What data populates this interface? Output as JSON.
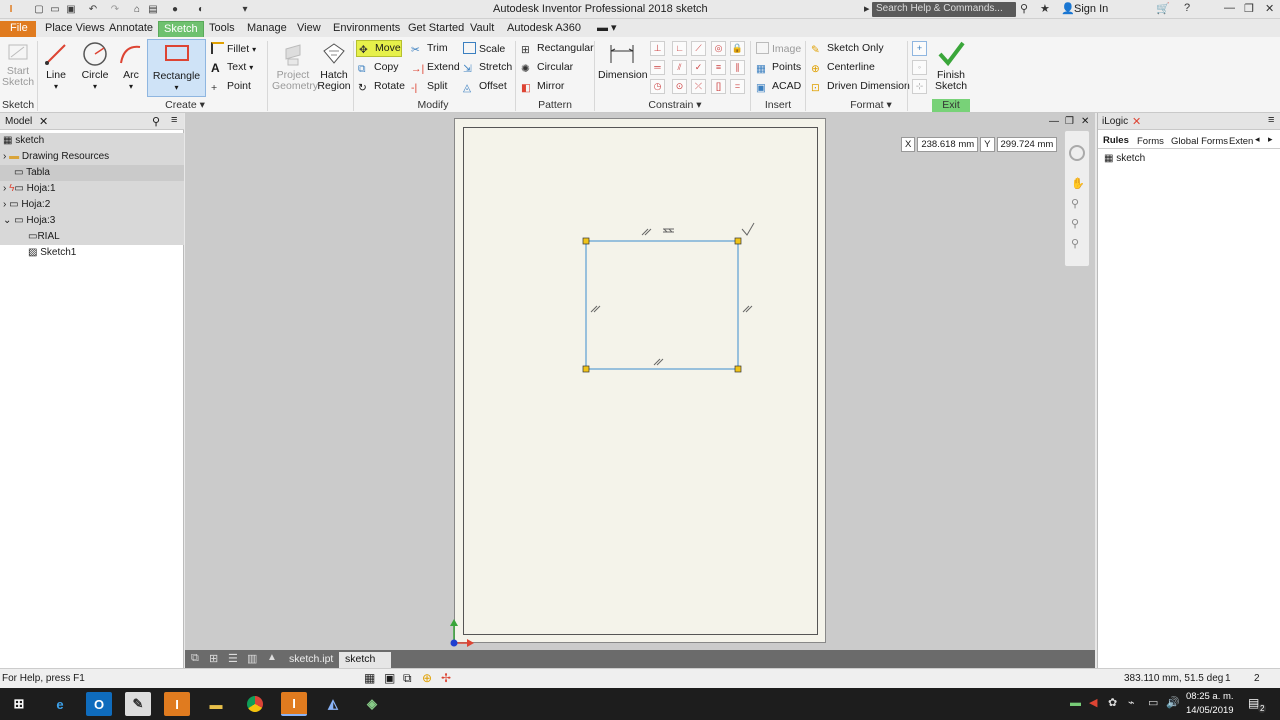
{
  "window": {
    "title": "Autodesk Inventor Professional 2018   sketch",
    "search_placeholder": "Search Help & Commands...",
    "sign_in": "Sign In"
  },
  "tabs": [
    "File",
    "Place Views",
    "Annotate",
    "Sketch",
    "Tools",
    "Manage",
    "View",
    "Environments",
    "Get Started",
    "Vault",
    "Autodesk A360"
  ],
  "ribbon": {
    "create": {
      "start_sketch": [
        "Start",
        "Sketch"
      ],
      "line": "Line",
      "circle": "Circle",
      "arc": "Arc",
      "rectangle": "Rectangle",
      "fillet": "Fillet",
      "text": "Text",
      "point": "Point",
      "project_geometry": [
        "Project",
        "Geometry"
      ],
      "hatch_region": [
        "Hatch",
        "Region"
      ]
    },
    "modify": {
      "move": "Move",
      "copy": "Copy",
      "rotate": "Rotate",
      "trim": "Trim",
      "extend": "Extend",
      "split": "Split",
      "scale": "Scale",
      "stretch": "Stretch",
      "offset": "Offset"
    },
    "pattern": {
      "rectangular": "Rectangular",
      "circular": "Circular",
      "mirror": "Mirror"
    },
    "dimension": "Dimension",
    "insert": {
      "image": "Image",
      "points": "Points",
      "acad": "ACAD"
    },
    "format": {
      "sketch_only": "Sketch Only",
      "centerline": "Centerline",
      "driven_dimension": "Driven Dimension"
    },
    "finish_sketch": [
      "Finish",
      "Sketch"
    ],
    "groups": {
      "sketch": "Sketch",
      "create": "Create",
      "modify": "Modify",
      "pattern": "Pattern",
      "constrain": "Constrain",
      "insert": "Insert",
      "format": "Format",
      "exit": "Exit"
    }
  },
  "model_panel": {
    "tab": "Model",
    "items": [
      "sketch",
      "Drawing Resources",
      "Tabla",
      "Hoja:1",
      "Hoja:2",
      "Hoja:3",
      "RIAL",
      "Sketch1"
    ]
  },
  "coords": {
    "x_label": "X",
    "x_value": "238.618 mm",
    "y_label": "Y",
    "y_value": "299.724 mm"
  },
  "doc_tabs": [
    "sketch.ipt",
    "sketch"
  ],
  "logic_panel": {
    "title": "iLogic",
    "tabs": [
      "Rules",
      "Forms",
      "Global Forms",
      "Exten"
    ],
    "root": "sketch"
  },
  "status": {
    "help": "For Help, press F1",
    "readout": "383.110 mm, 51.5 deg",
    "value1": "1",
    "value2": "2"
  },
  "taskbar": {
    "time": "08:25 a. m.",
    "date": "14/05/2019",
    "notifications": "2"
  },
  "colors": {
    "file_tab": "#e07b1f",
    "sketch_tab": "#6fc16f",
    "move_highlight": "#e6f04a",
    "rect_line": "#5b9fd3",
    "handle": "#f0c419",
    "exit_green": "#78d278"
  }
}
